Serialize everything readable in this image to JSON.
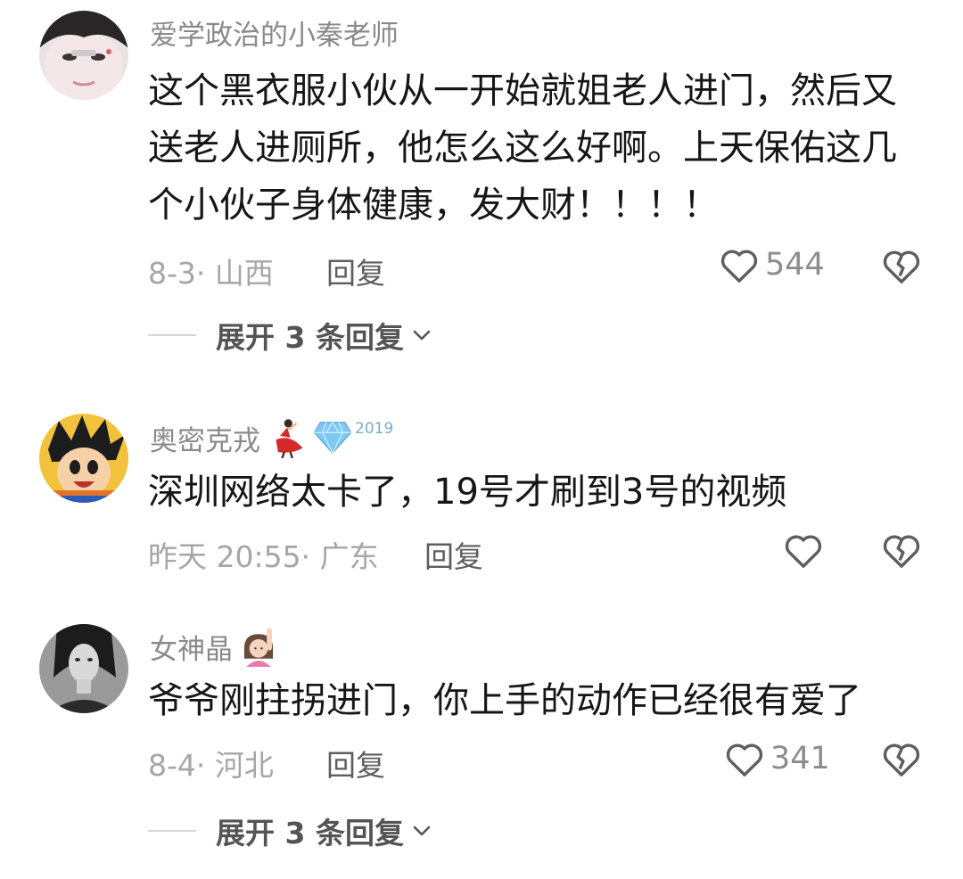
{
  "comments": [
    {
      "username": "爱学政治的小秦老师",
      "text": "这个黑衣服小伙从一开始就姐老人进门，然后又\n送老人进厕所，他怎么这么好啊。上天保佑这几\n个小伙子身体健康，发大财！！！！",
      "meta": "8-3· 山西",
      "reply_label": "回复",
      "likes": "544",
      "expand_label": "展开 3 条回复"
    },
    {
      "username": "奥密克戎",
      "badge_year": "2019",
      "text": "深圳网络太卡了，19号才刷到3号的视频",
      "meta": "昨天 20:55· 广东",
      "reply_label": "回复",
      "likes": ""
    },
    {
      "username": "女神晶",
      "text": "爷爷刚拄拐进门，你上手的动作已经很有爱了",
      "meta": "8-4· 河北",
      "reply_label": "回复",
      "likes": "341",
      "expand_label": "展开 3 条回复"
    }
  ],
  "icons": {
    "like": "heart-outline-icon",
    "dislike": "broken-heart-icon",
    "expand": "chevron-down-icon"
  }
}
